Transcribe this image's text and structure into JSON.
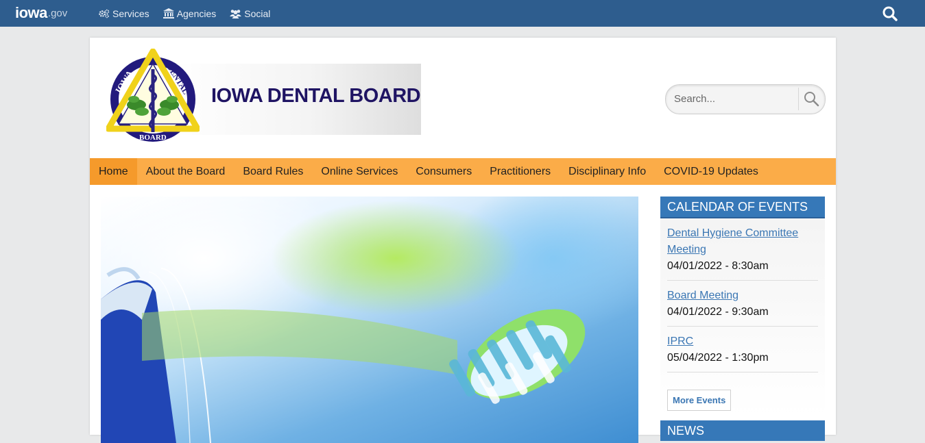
{
  "topbar": {
    "logo_main": "iowa",
    "logo_suffix": ".gov",
    "nav": [
      {
        "label": "Services",
        "icon": "gears-icon"
      },
      {
        "label": "Agencies",
        "icon": "building-icon"
      },
      {
        "label": "Social",
        "icon": "users-icon"
      }
    ],
    "search_icon": "search-icon"
  },
  "header": {
    "title": "IOWA DENTAL BOARD",
    "seal_text": {
      "left": "IOWA",
      "right": "DENTAL",
      "bottom": "BOARD"
    },
    "search_placeholder": "Search..."
  },
  "main_nav": [
    {
      "label": "Home",
      "active": true
    },
    {
      "label": "About the Board"
    },
    {
      "label": "Board Rules"
    },
    {
      "label": "Online Services"
    },
    {
      "label": "Consumers"
    },
    {
      "label": "Practitioners"
    },
    {
      "label": "Disciplinary Info"
    },
    {
      "label": "COVID-19 Updates"
    }
  ],
  "calendar": {
    "heading": "CALENDAR OF EVENTS",
    "events": [
      {
        "title": "Dental Hygiene Committee Meeting",
        "date": "04/01/2022 - 8:30am"
      },
      {
        "title": "Board Meeting",
        "date": "04/01/2022 - 9:30am"
      },
      {
        "title": "IPRC",
        "date": "05/04/2022 - 1:30pm"
      }
    ],
    "more_label": "More Events"
  },
  "news": {
    "heading": "NEWS"
  },
  "colors": {
    "topbar": "#2e5d8e",
    "nav_orange": "#fbac48",
    "nav_active": "#f59a2b",
    "sidebar_blue": "#3678b8",
    "link": "#3a76b3",
    "title_navy": "#1f1463"
  }
}
